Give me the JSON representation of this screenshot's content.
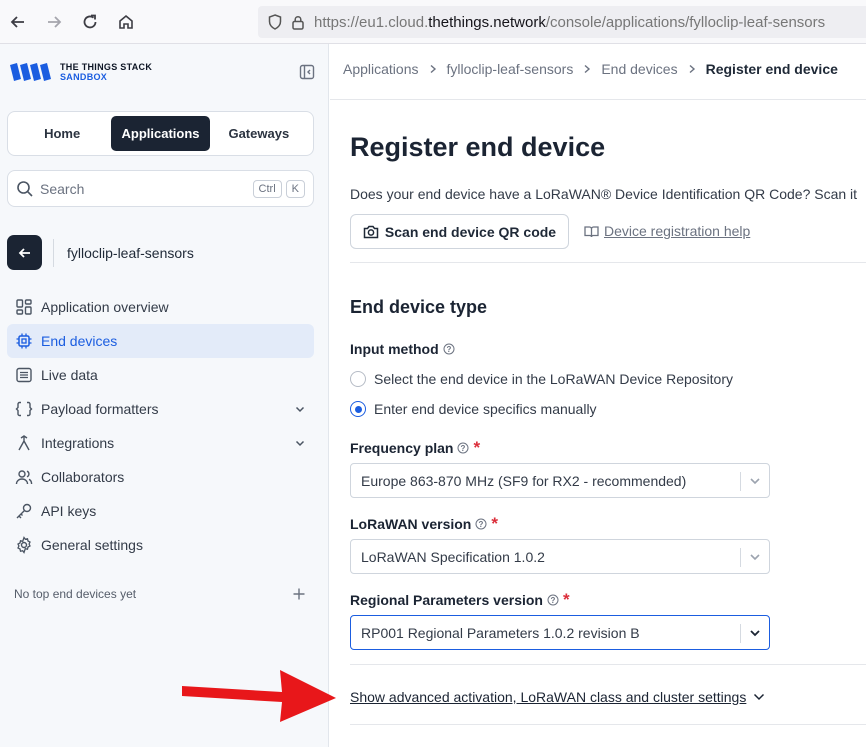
{
  "browser": {
    "url_prefix": "https://eu1.cloud.",
    "url_domain": "thethings.network",
    "url_suffix": "/console/applications/fylloclip-leaf-sensors"
  },
  "sidebar": {
    "logo_line1": "THE THINGS STACK",
    "logo_line2": "SANDBOX",
    "tabs": [
      "Home",
      "Applications",
      "Gateways"
    ],
    "search_placeholder": "Search",
    "search_keys": [
      "Ctrl",
      "K"
    ],
    "app_name": "fylloclip-leaf-sensors",
    "items": [
      {
        "label": "Application overview",
        "icon": "overview-icon"
      },
      {
        "label": "End devices",
        "icon": "chip-icon"
      },
      {
        "label": "Live data",
        "icon": "list-icon"
      },
      {
        "label": "Payload formatters",
        "icon": "code-icon"
      },
      {
        "label": "Integrations",
        "icon": "integrations-icon"
      },
      {
        "label": "Collaborators",
        "icon": "users-icon"
      },
      {
        "label": "API keys",
        "icon": "key-icon"
      },
      {
        "label": "General settings",
        "icon": "gear-icon"
      }
    ],
    "no_top_devices": "No top end devices yet"
  },
  "breadcrumb": [
    "Applications",
    "fylloclip-leaf-sensors",
    "End devices",
    "Register end device"
  ],
  "page": {
    "title": "Register end device",
    "qr_question": "Does your end device have a LoRaWAN® Device Identification QR Code? Scan it",
    "scan_button": "Scan end device QR code",
    "help_link": "Device registration help",
    "section_title": "End device type",
    "input_method_label": "Input method",
    "radio_repository": "Select the end device in the LoRaWAN Device Repository",
    "radio_manual": "Enter end device specifics manually",
    "frequency_plan_label": "Frequency plan",
    "frequency_plan_value": "Europe 863-870 MHz (SF9 for RX2 - recommended)",
    "lorawan_version_label": "LoRaWAN version",
    "lorawan_version_value": "LoRaWAN Specification 1.0.2",
    "regional_params_label": "Regional Parameters version",
    "regional_params_value": "RP001 Regional Parameters 1.0.2 revision B",
    "required_mark": "*",
    "advanced_link": "Show advanced activation, LoRaWAN class and cluster settings"
  },
  "colors": {
    "accent": "#1b5de0",
    "dark": "#1b2433",
    "required": "#db2e3a",
    "annotation_arrow": "#e8171a"
  }
}
